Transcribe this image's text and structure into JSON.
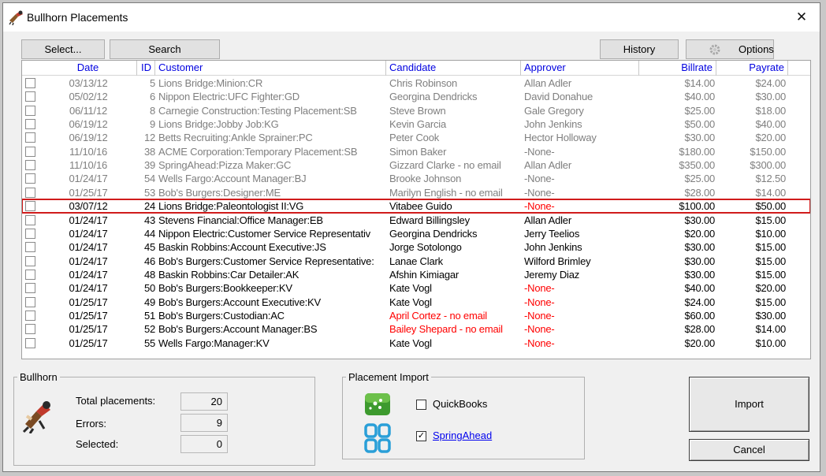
{
  "window": {
    "title": "Bullhorn Placements",
    "close_glyph": "✕"
  },
  "toolbar": {
    "select_label": "Select...",
    "search_label": "Search",
    "history_label": "History",
    "options_label": "Options"
  },
  "grid": {
    "headers": [
      "Date",
      "ID",
      "Customer",
      "Candidate",
      "Approver",
      "Billrate",
      "Payrate"
    ],
    "rows": [
      {
        "date": "03/13/12",
        "id": "5",
        "customer": "Lions Bridge:Minion:CR",
        "candidate": "Chris Robinson",
        "approver": "Allan Adler",
        "billrate": "$14.00",
        "payrate": "$24.00",
        "style": "grey"
      },
      {
        "date": "05/02/12",
        "id": "6",
        "customer": "Nippon Electric:UFC Fighter:GD",
        "candidate": "Georgina Dendricks",
        "approver": "David Donahue",
        "billrate": "$40.00",
        "payrate": "$30.00",
        "style": "grey"
      },
      {
        "date": "06/11/12",
        "id": "8",
        "customer": "Carnegie Construction:Testing Placement:SB",
        "candidate": "Steve Brown",
        "approver": "Gale Gregory",
        "billrate": "$25.00",
        "payrate": "$18.00",
        "style": "grey"
      },
      {
        "date": "06/19/12",
        "id": "9",
        "customer": "Lions Bridge:Jobby Job:KG",
        "candidate": "Kevin Garcia",
        "approver": "John Jenkins",
        "billrate": "$50.00",
        "payrate": "$40.00",
        "style": "grey"
      },
      {
        "date": "06/19/12",
        "id": "12",
        "customer": "Betts Recruiting:Ankle Sprainer:PC",
        "candidate": "Peter Cook",
        "approver": "Hector Holloway",
        "billrate": "$30.00",
        "payrate": "$20.00",
        "style": "grey"
      },
      {
        "date": "11/10/16",
        "id": "38",
        "customer": "ACME Corporation:Temporary Placement:SB",
        "candidate": "Simon Baker",
        "approver": "-None-",
        "billrate": "$180.00",
        "payrate": "$150.00",
        "style": "grey"
      },
      {
        "date": "11/10/16",
        "id": "39",
        "customer": "SpringAhead:Pizza Maker:GC",
        "candidate": "Gizzard Clarke - no email",
        "approver": "Allan Adler",
        "billrate": "$350.00",
        "payrate": "$300.00",
        "style": "grey"
      },
      {
        "date": "01/24/17",
        "id": "54",
        "customer": "Wells Fargo:Account Manager:BJ",
        "candidate": "Brooke Johnson",
        "approver": "-None-",
        "billrate": "$25.00",
        "payrate": "$12.50",
        "style": "grey"
      },
      {
        "date": "01/25/17",
        "id": "53",
        "customer": "Bob's Burgers:Designer:ME",
        "candidate": "Marilyn English - no email",
        "approver": "-None-",
        "billrate": "$28.00",
        "payrate": "$14.00",
        "style": "grey"
      },
      {
        "date": "03/07/12",
        "id": "24",
        "customer": "Lions Bridge:Paleontologist II:VG",
        "candidate": "Vitabee Guido",
        "approver": "-None-",
        "billrate": "$100.00",
        "payrate": "$50.00",
        "style": "selected",
        "approver_red": true
      },
      {
        "date": "01/24/17",
        "id": "43",
        "customer": "Stevens Financial:Office Manager:EB",
        "candidate": "Edward Billingsley",
        "approver": "Allan Adler",
        "billrate": "$30.00",
        "payrate": "$15.00",
        "style": "normal"
      },
      {
        "date": "01/24/17",
        "id": "44",
        "customer": "Nippon Electric:Customer Service Representativ",
        "candidate": "Georgina Dendricks",
        "approver": "Jerry Teelios",
        "billrate": "$20.00",
        "payrate": "$10.00",
        "style": "normal"
      },
      {
        "date": "01/24/17",
        "id": "45",
        "customer": "Baskin Robbins:Account Executive:JS",
        "candidate": "Jorge Sotolongo",
        "approver": "John Jenkins",
        "billrate": "$30.00",
        "payrate": "$15.00",
        "style": "normal"
      },
      {
        "date": "01/24/17",
        "id": "46",
        "customer": "Bob's Burgers:Customer Service Representative:",
        "candidate": "Lanae Clark",
        "approver": "Wilford Brimley",
        "billrate": "$30.00",
        "payrate": "$15.00",
        "style": "normal"
      },
      {
        "date": "01/24/17",
        "id": "48",
        "customer": "Baskin Robbins:Car Detailer:AK",
        "candidate": "Afshin Kimiagar",
        "approver": "Jeremy Diaz",
        "billrate": "$30.00",
        "payrate": "$15.00",
        "style": "normal"
      },
      {
        "date": "01/24/17",
        "id": "50",
        "customer": "Bob's Burgers:Bookkeeper:KV",
        "candidate": "Kate Vogl",
        "approver": "-None-",
        "billrate": "$40.00",
        "payrate": "$20.00",
        "style": "normal",
        "approver_red": true
      },
      {
        "date": "01/25/17",
        "id": "49",
        "customer": "Bob's Burgers:Account Executive:KV",
        "candidate": "Kate Vogl",
        "approver": "-None-",
        "billrate": "$24.00",
        "payrate": "$15.00",
        "style": "normal",
        "approver_red": true
      },
      {
        "date": "01/25/17",
        "id": "51",
        "customer": "Bob's Burgers:Custodian:AC",
        "candidate": "April Cortez - no email",
        "approver": "-None-",
        "billrate": "$60.00",
        "payrate": "$30.00",
        "style": "normal",
        "candidate_red": true,
        "approver_red": true
      },
      {
        "date": "01/25/17",
        "id": "52",
        "customer": "Bob's Burgers:Account Manager:BS",
        "candidate": "Bailey Shepard - no email",
        "approver": "-None-",
        "billrate": "$28.00",
        "payrate": "$14.00",
        "style": "normal",
        "candidate_red": true,
        "approver_red": true
      },
      {
        "date": "01/25/17",
        "id": "55",
        "customer": "Wells Fargo:Manager:KV",
        "candidate": "Kate Vogl",
        "approver": "-None-",
        "billrate": "$20.00",
        "payrate": "$10.00",
        "style": "normal",
        "approver_red": true
      }
    ]
  },
  "bullhorn": {
    "legend": "Bullhorn",
    "total_label": "Total placements:",
    "total_value": "20",
    "errors_label": "Errors:",
    "errors_value": "9",
    "selected_label": "Selected:",
    "selected_value": "0"
  },
  "placement_import": {
    "legend": "Placement Import",
    "quickbooks_label": "QuickBooks",
    "quickbooks_checked": false,
    "springahead_label": "SpringAhead",
    "springahead_checked": true
  },
  "actions": {
    "import_label": "Import",
    "cancel_label": "Cancel"
  },
  "colors": {
    "header_text": "#0000e0",
    "error_red": "#ff0000",
    "selection_outline": "#d01c1c",
    "link": "#0000ee"
  }
}
